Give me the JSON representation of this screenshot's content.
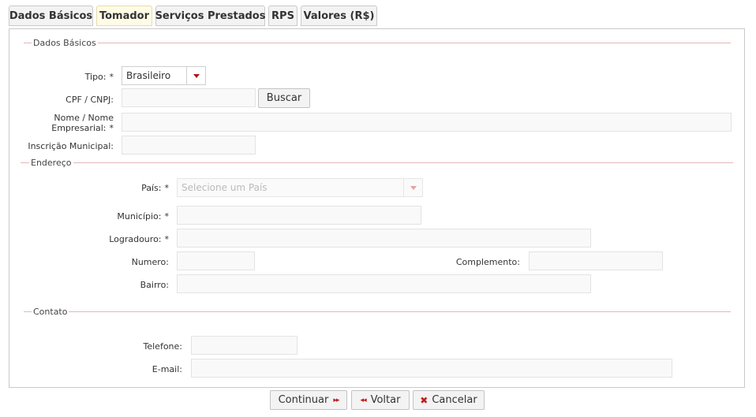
{
  "tabs": [
    {
      "label": "Dados Básicos"
    },
    {
      "label": "Tomador"
    },
    {
      "label": "Serviços Prestados"
    },
    {
      "label": "RPS"
    },
    {
      "label": "Valores (R$)"
    }
  ],
  "sections": {
    "dados_basicos": "Dados Básicos",
    "endereco": "Endereço",
    "contato": "Contato"
  },
  "required_mark": "*",
  "form": {
    "tipo": {
      "label": "Tipo:",
      "value": "Brasileiro"
    },
    "cpf_cnpj": {
      "label": "CPF / CNPJ:",
      "value": "",
      "button": "Buscar"
    },
    "nome": {
      "label_line1": "Nome / Nome",
      "label_line2": "Empresarial:",
      "value": ""
    },
    "inscricao": {
      "label": "Inscrição Municipal:",
      "value": ""
    },
    "pais": {
      "label": "País:",
      "placeholder": "Selecione um País"
    },
    "municipio": {
      "label": "Município:",
      "value": ""
    },
    "logradouro": {
      "label": "Logradouro:",
      "value": ""
    },
    "numero": {
      "label": "Numero:",
      "value": ""
    },
    "complemento": {
      "label": "Complemento:",
      "value": ""
    },
    "bairro": {
      "label": "Bairro:",
      "value": ""
    },
    "telefone": {
      "label": "Telefone:",
      "value": ""
    },
    "email": {
      "label": "E-mail:",
      "value": ""
    }
  },
  "actions": {
    "continuar": "Continuar",
    "voltar": "Voltar",
    "cancelar": "Cancelar"
  },
  "icons": {
    "continuar": "forward-arrows-icon",
    "voltar": "back-arrows-icon",
    "cancelar": "close-x-icon",
    "dropdown": "dropdown-arrow-icon"
  },
  "colors": {
    "accent": "#b01515",
    "active_tab_bg": "#fefbe6",
    "section_line": "#e2b7b7"
  }
}
